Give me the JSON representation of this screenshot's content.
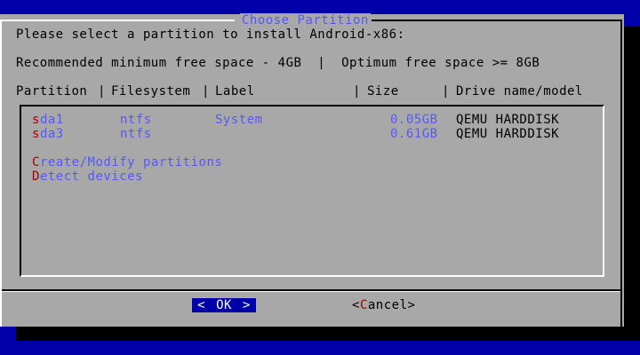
{
  "dialog": {
    "title": "Choose Partition",
    "prompt": "Please select a partition to install Android-x86:",
    "space_info": "Recommended minimum free space - 4GB  |  Optimum free space >= 8GB",
    "columns": {
      "partition": "Partition",
      "filesystem": "Filesystem",
      "label": "Label",
      "size": "Size",
      "drive": "Drive name/model",
      "sep": "|"
    }
  },
  "partitions": [
    {
      "hotkey": "s",
      "name_rest": "da1",
      "filesystem": "ntfs",
      "label": "System",
      "size": "0.05GB",
      "drive": "QEMU HARDDISK"
    },
    {
      "hotkey": "s",
      "name_rest": "da3",
      "filesystem": "ntfs",
      "label": "",
      "size": "0.61GB",
      "drive": "QEMU HARDDISK"
    }
  ],
  "actions": [
    {
      "hotkey": "C",
      "rest": "reate/Modify partitions"
    },
    {
      "hotkey": "D",
      "rest": "etect devices"
    }
  ],
  "buttons": {
    "ok": {
      "left": "<",
      "hotkey": "OK",
      "right": ">"
    },
    "cancel": {
      "left": "<",
      "hotkey": "C",
      "rest": "ancel",
      "right": ">"
    }
  },
  "colors": {
    "desktop": "#0000a8",
    "dialog": "#a8a8a8",
    "item_text": "#5858f8",
    "hotkey": "#a80000"
  }
}
